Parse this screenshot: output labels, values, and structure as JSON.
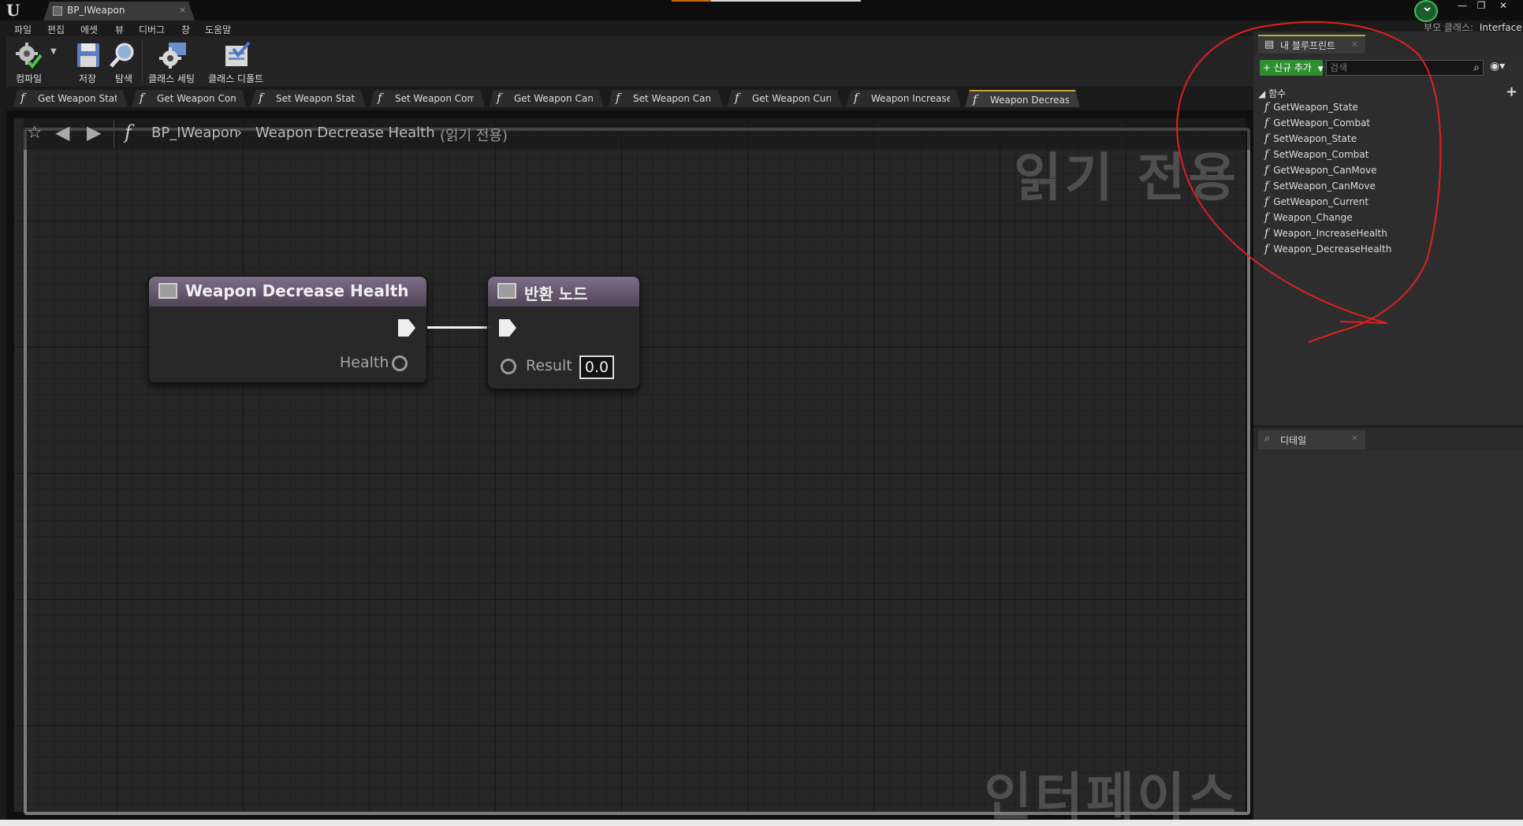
{
  "window": {
    "doc_tab": "BP_IWeapon",
    "parent_class_label": "부모 클래스:",
    "parent_class_value": "Interface"
  },
  "menu": [
    "파일",
    "편집",
    "에셋",
    "뷰",
    "디버그",
    "창",
    "도움말"
  ],
  "toolbar": {
    "compile": "컴파일",
    "save": "저장",
    "browse": "탐색",
    "class_settings": "클래스 세팅",
    "class_defaults": "클래스 디폴트"
  },
  "function_tabs": [
    {
      "label": "Get Weapon State",
      "active": false
    },
    {
      "label": "Get Weapon Comb",
      "active": false
    },
    {
      "label": "Set Weapon State",
      "active": false
    },
    {
      "label": "Set Weapon Comb",
      "active": false
    },
    {
      "label": "Get Weapon Can M",
      "active": false
    },
    {
      "label": "Set Weapon Can M",
      "active": false
    },
    {
      "label": "Get Weapon Currer",
      "active": false
    },
    {
      "label": "Weapon Increase H",
      "active": false
    },
    {
      "label": "Weapon Decrease",
      "active": true
    }
  ],
  "graph": {
    "breadcrumb_class": "BP_IWeapon",
    "breadcrumb_function": "Weapon Decrease Health",
    "readonly_suffix": "(읽기 전용)",
    "watermark_readonly": "읽기 전용",
    "watermark_interface": "인터페이스",
    "zoom": "1:1",
    "entry_node": {
      "title": "Weapon Decrease Health",
      "output_pin": "Health"
    },
    "return_node": {
      "title": "반환 노드",
      "input_pin": "Result",
      "input_value": "0.0"
    }
  },
  "my_blueprint": {
    "tab": "내 블루프린트",
    "add_new": "+ 신규 추가",
    "search_placeholder": "검색",
    "section": "함수",
    "functions": [
      "GetWeapon_State",
      "GetWeapon_Combat",
      "SetWeapon_State",
      "SetWeapon_Combat",
      "GetWeapon_CanMove",
      "SetWeapon_CanMove",
      "GetWeapon_Current",
      "Weapon_Change",
      "Weapon_IncreaseHealth",
      "Weapon_DecreaseHealth"
    ]
  },
  "details": {
    "tab": "디테일"
  },
  "colors": {
    "accent": "#c6a43a",
    "add_button": "#2f8f2f",
    "node_header": "#7d6e88",
    "annotation": "#e02020",
    "badge": "#3fbf5a"
  },
  "icons": {
    "compile": "gear-check-icon",
    "save": "floppy-icon",
    "browse": "magnifier-icon",
    "class_settings": "gear-icon",
    "class_defaults": "checklist-icon",
    "function": "function-f-icon"
  }
}
